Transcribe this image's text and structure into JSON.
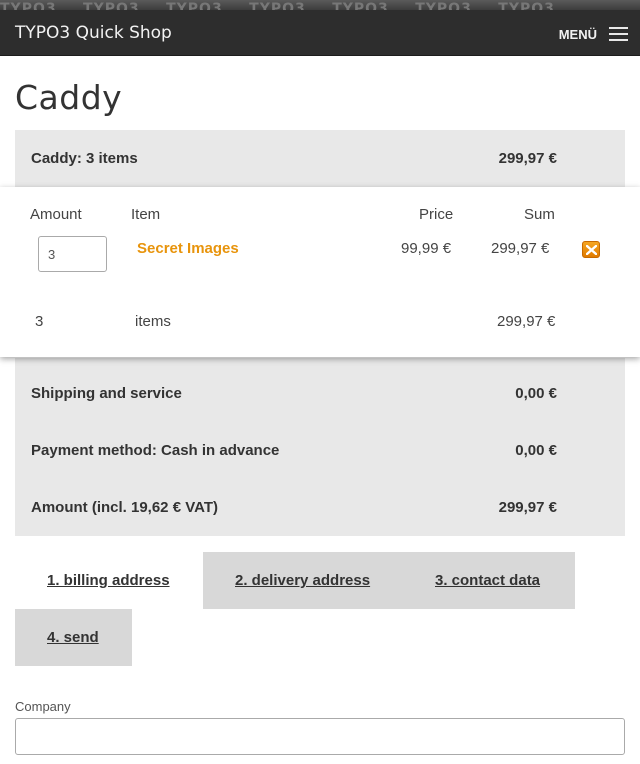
{
  "banner": {
    "watermark": "TYPO3"
  },
  "navbar": {
    "brand": "TYPO3 Quick Shop",
    "menu_label": "MENÜ"
  },
  "page": {
    "title": "Caddy"
  },
  "cart_summary": {
    "label": "Caddy: 3 items",
    "total": "299,97 €"
  },
  "table": {
    "headers": {
      "amount": "Amount",
      "item": "Item",
      "price": "Price",
      "sum": "Sum"
    },
    "rows": [
      {
        "quantity": "3",
        "item": "Secret Images",
        "price": "99,99 €",
        "sum": "299,97 €"
      }
    ],
    "footer": {
      "count": "3",
      "label": "items",
      "sum": "299,97 €"
    }
  },
  "totals": {
    "shipping": {
      "label": "Shipping and service",
      "value": "0,00 €"
    },
    "payment": {
      "label": "Payment method: Cash in advance",
      "value": "0,00 €"
    },
    "amount": {
      "label": "Amount (incl. 19,62 € VAT)",
      "value": "299,97 €"
    }
  },
  "steps": [
    {
      "label": "1. billing address",
      "active": true
    },
    {
      "label": "2. delivery address",
      "active": false
    },
    {
      "label": "3. contact data",
      "active": false
    },
    {
      "label": "4. send",
      "active": false
    }
  ],
  "form": {
    "company_label": "Company",
    "company_value": ""
  },
  "colors": {
    "accent": "#e8940c",
    "nav_bg": "#2d2d2d",
    "row_bg": "#e8e8e8",
    "tab_bg": "#d8d8d8"
  }
}
